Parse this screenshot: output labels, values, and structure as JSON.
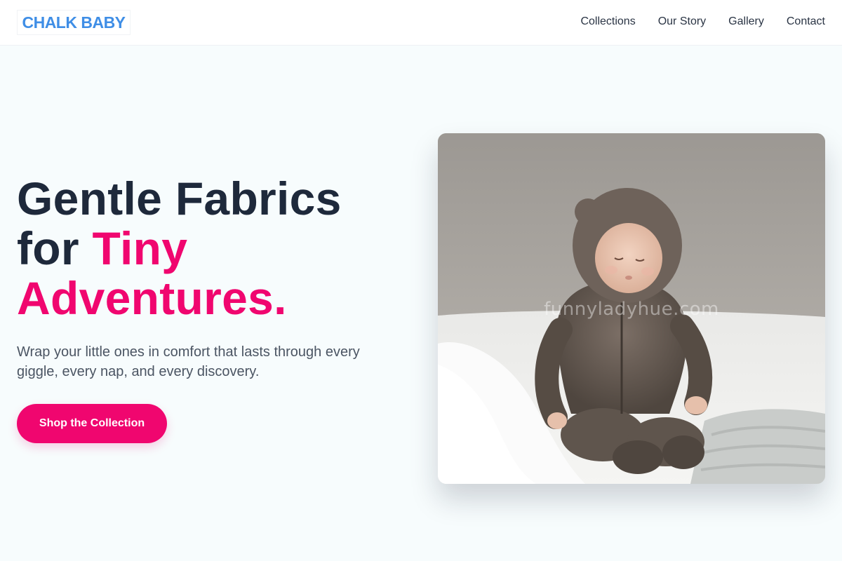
{
  "brand": {
    "name": "CHALK BABY",
    "color": "#3f8ee6"
  },
  "nav": {
    "items": [
      "Collections",
      "Our Story",
      "Gallery",
      "Contact"
    ]
  },
  "hero": {
    "title_line1": "Gentle Fabrics",
    "title_line2_plain": "for ",
    "title_line2_accent": "Tiny",
    "title_line3_accent": "Adventures.",
    "subtitle": "Wrap your little ones in comfort that lasts through every giggle, every nap, and every discovery.",
    "cta_label": "Shop the Collection",
    "accent_color": "#f0066f",
    "image": {
      "description_icon": "baby-photo",
      "watermark": "funnyladyhue.com"
    }
  }
}
